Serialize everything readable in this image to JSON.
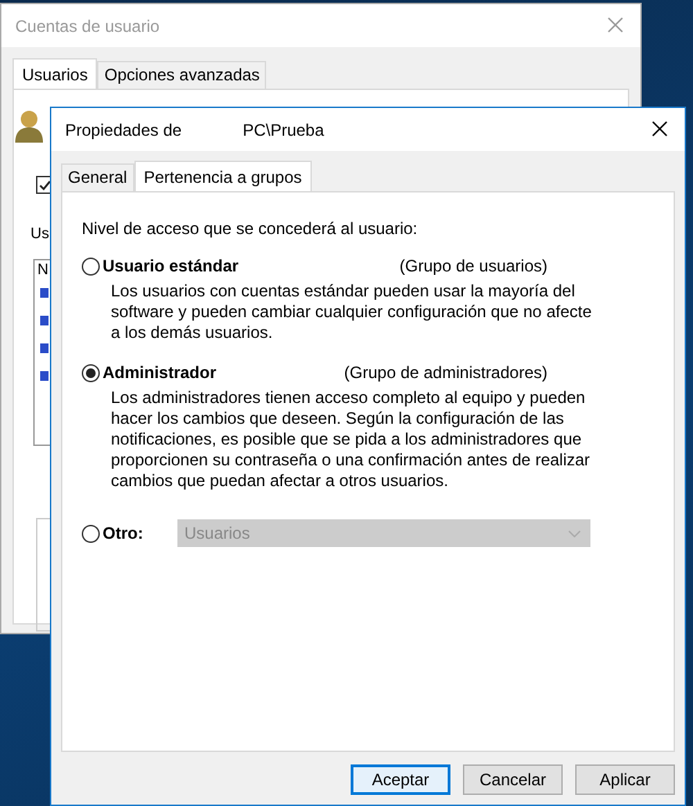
{
  "back_window": {
    "title": "Cuentas de usuario",
    "tabs": [
      {
        "label": "Usuarios",
        "selected": true
      },
      {
        "label": "Opciones avanzadas",
        "selected": false
      }
    ],
    "checkbox": {
      "checked": true
    },
    "section_label": "Us",
    "list_header": "N"
  },
  "dialog": {
    "title": "Propiedades de",
    "user": "PC\\Prueba",
    "tabs": [
      {
        "label": "General",
        "selected": false
      },
      {
        "label": "Pertenencia a grupos",
        "selected": true
      }
    ],
    "prompt": "Nivel de acceso que se concederá al usuario:",
    "options": [
      {
        "kind": "description",
        "label": "Usuario estándar",
        "group": "(Grupo de usuarios)",
        "selected": false,
        "lines": [
          "Los usuarios con cuentas estándar pueden usar la mayoría del",
          "software y pueden cambiar cualquier configuración que no afecte",
          "a los demás usuarios."
        ]
      },
      {
        "kind": "description",
        "label": "Administrador",
        "group": "(Grupo de administradores)",
        "selected": true,
        "lines": [
          "Los administradores tienen acceso completo al equipo y pueden",
          "hacer los cambios que deseen. Según la configuración de las",
          "notificaciones, es posible que se pida a los administradores que",
          "proporcionen su contraseña o una confirmación antes de realizar",
          "cambios que puedan afectar a otros usuarios."
        ]
      },
      {
        "kind": "dropdown",
        "label": "Otro:",
        "selected": false,
        "value": "Usuarios",
        "disabled": true
      }
    ],
    "buttons": [
      {
        "label": "Aceptar",
        "default": true
      },
      {
        "label": "Cancelar",
        "default": false
      },
      {
        "label": "Aplicar",
        "default": false
      }
    ]
  }
}
